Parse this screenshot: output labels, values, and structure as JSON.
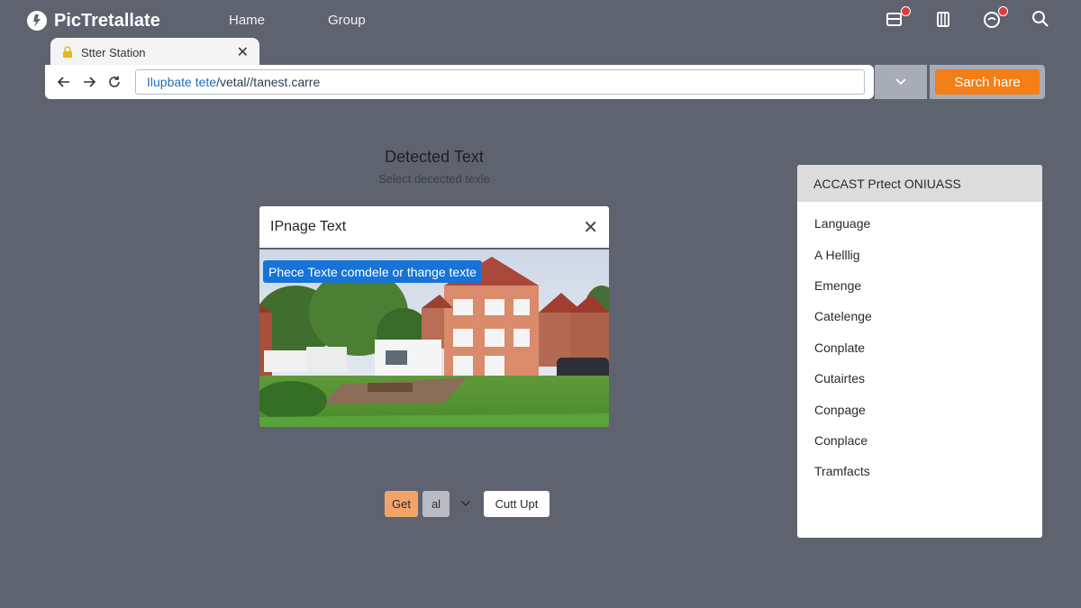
{
  "app": {
    "name": "PicTretallate",
    "nav": [
      {
        "label": "Hame"
      },
      {
        "label": "Group"
      }
    ]
  },
  "browser": {
    "tab_title": "Stter Station",
    "url": {
      "prefix": "Ilupbate tete",
      "rest": " /vetal//tanest.carre"
    },
    "search_label": "Sarch hare"
  },
  "detected": {
    "title": "Detected Text",
    "subtitle": "Select decected texle"
  },
  "image_card": {
    "title": "IPnage Text",
    "overlay_tag": "Phece Texte comdele or thange texte"
  },
  "controls": {
    "get_label": "Get",
    "al_label": "al",
    "cut_label": "Cutt Upt"
  },
  "panel": {
    "header": "ACCAST Prtect ONIUASS",
    "items": [
      "Language",
      "A Helllig",
      "Emenge",
      "Catelenge",
      "Conplate",
      "Cutairtes",
      "Conpage",
      "Conplace",
      "Tramfacts"
    ]
  },
  "colors": {
    "background": "#5f6370",
    "accent_orange": "#f47e17",
    "tag_blue": "#1673d8",
    "badge_red": "#e23b3b"
  },
  "icons": {
    "top_bar": [
      "inbox-icon",
      "clipboard-icon",
      "notification-icon",
      "search-icon"
    ]
  }
}
